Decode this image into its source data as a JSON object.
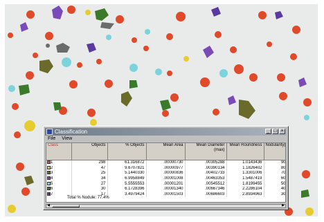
{
  "window": {
    "title": "Classification",
    "menu": [
      "File",
      "View"
    ],
    "controls": {
      "minimize": "_",
      "maximize": "□",
      "close": "×"
    }
  },
  "table": {
    "headers": [
      "Class",
      "Objects",
      "% Objects",
      "Mean Area",
      "Mean Diameter (max)",
      "Mean Roundness",
      "Nodularity(%)"
    ],
    "rows": [
      {
        "class_no": "1",
        "color": "#e04a2a",
        "objects": "298",
        "pct": "61.316872",
        "area": ".00000730",
        "diam": ".00305288",
        "round": "1.0143436",
        "nod": "90"
      },
      {
        "class_no": "2",
        "color": "#e6cc2e",
        "objects": "47",
        "pct": "9.6707821",
        "area": ".00000977",
        "diam": ".00390134",
        "round": "1.1826402",
        "nod": "80"
      },
      {
        "class_no": "3",
        "color": "#6a6a2a",
        "objects": "25",
        "pct": "5.1440330",
        "area": ".00000836",
        "diam": ".00402733",
        "round": "1.3301006",
        "nod": "70"
      },
      {
        "class_no": "4",
        "color": "#7a4ab8",
        "objects": "34",
        "pct": "6.9958849",
        "area": ".00001008",
        "diam": ".00463353",
        "round": "1.5487419",
        "nod": "60"
      },
      {
        "class_no": "5",
        "color": "#7dd3dc",
        "objects": "27",
        "pct": "5.5555553",
        "area": ".00001201",
        "diam": ".00545512",
        "round": "1.8199455",
        "nod": "50"
      },
      {
        "class_no": "6",
        "color": "#3a7a2a",
        "objects": "30",
        "pct": "6.1728396",
        "area": ".00001340",
        "diam": ".00667346",
        "round": "2.2286104",
        "nod": "40"
      },
      {
        "class_no": "7",
        "color": "#5a3aa0",
        "objects": "17",
        "pct": "3.4979424",
        "area": ".00001503",
        "diam": ".00686603",
        "round": "2.8934963",
        "nod": "30"
      }
    ],
    "total_label": "Total % Nodule:",
    "total_value": "77.4%"
  },
  "colors": {
    "background": "#e9ebeb",
    "red": "#e04a2a",
    "yellow": "#e6cc2e",
    "olive": "#6a6a2a",
    "purple": "#7a4ab8",
    "cyan": "#7dd3dc",
    "green": "#3a7a2a",
    "dark_violet": "#5a3aa0",
    "titlebar": "#6e7b88"
  }
}
